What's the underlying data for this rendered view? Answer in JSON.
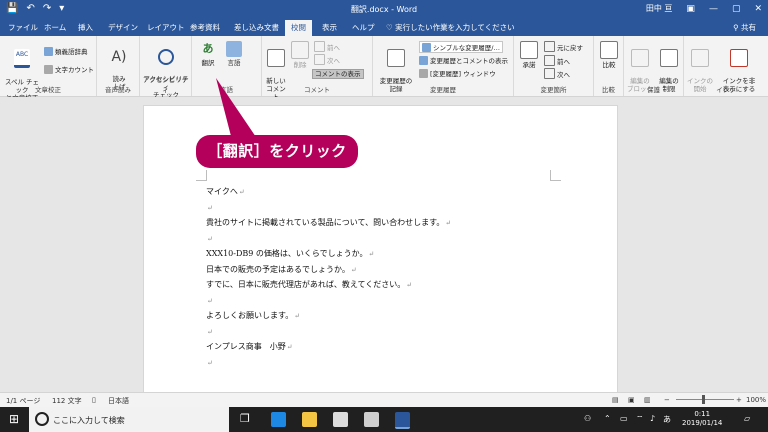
{
  "titlebar": {
    "title": "翻訳.docx  -  Word",
    "user": "田中 亘",
    "save_icon": "💾",
    "undo_icon": "↶",
    "redo_icon": "↷",
    "qat_more": "▾",
    "ribbon_display_icon": "▣",
    "minimize_icon": "—",
    "maximize_icon": "▢",
    "close_icon": "✕"
  },
  "tabs": [
    "ファイル",
    "ホーム",
    "挿入",
    "デザイン",
    "レイアウト",
    "参考資料",
    "差し込み文書",
    "校閲",
    "表示",
    "ヘルプ"
  ],
  "active_tab": "校閲",
  "tell_me": "実行したい作業を入力してください",
  "share": "共有",
  "ribbon": {
    "proofing": {
      "label": "文章校正",
      "spelling": "スペル チェック\nと文章校正",
      "thesaurus": "類義語辞典",
      "word_count": "文字カウント"
    },
    "speech": {
      "label": "音声読み",
      "read_aloud": "読み\n上げ"
    },
    "accessibility": {
      "label": "アクセシビリティ",
      "check": "アクセシビリティ\nチェック"
    },
    "language": {
      "label": "言語",
      "translate": "翻訳",
      "language": "言語"
    },
    "comments": {
      "label": "コメント",
      "new": "新しい\nコメント",
      "delete": "削除",
      "prev": "前へ",
      "next": "次へ",
      "show": "コメントの表示"
    },
    "tracking": {
      "label": "変更履歴",
      "track": "変更履歴の\n記録",
      "markup": "シンプルな変更履歴/…",
      "show_markup": "変更履歴とコメントの表示",
      "pane": "[変更履歴] ウィンドウ"
    },
    "changes": {
      "label": "変更箇所",
      "accept": "承諾",
      "reject": "元に戻す",
      "prev": "前へ",
      "next": "次へ"
    },
    "compare": {
      "label": "比較",
      "compare": "比較"
    },
    "protect": {
      "label": "保護",
      "block": "編集の\nブロック",
      "restrict": "編集の\n制限"
    },
    "ink": {
      "label": "インク",
      "start": "インクの\n開始",
      "hide": "インクを非\n表示にする"
    }
  },
  "callout": "［翻訳］をクリック",
  "document": {
    "lines": [
      "マイクへ",
      "",
      "貴社のサイトに掲載されている製品について、問い合わせします。",
      "",
      "XXX10-DB9 の価格は、いくらでしょうか。",
      "日本での販売の予定はあるでしょうか。",
      "すでに、日本に販売代理店があれば、教えてください。",
      "",
      "よろしくお願いします。",
      "",
      "インプレス商事　小野",
      ""
    ],
    "paragraph_mark": "↵"
  },
  "statusbar": {
    "page": "1/1 ページ",
    "words": "112 文字",
    "language": "日本語",
    "zoom": "100%",
    "zoom_minus": "−",
    "zoom_plus": "+"
  },
  "taskbar": {
    "search_placeholder": "ここに入力して検索",
    "time": "0:11",
    "date": "2019/01/14",
    "ime": "あ"
  },
  "colors": {
    "word_blue": "#2b579a",
    "callout": "#b4005a"
  }
}
